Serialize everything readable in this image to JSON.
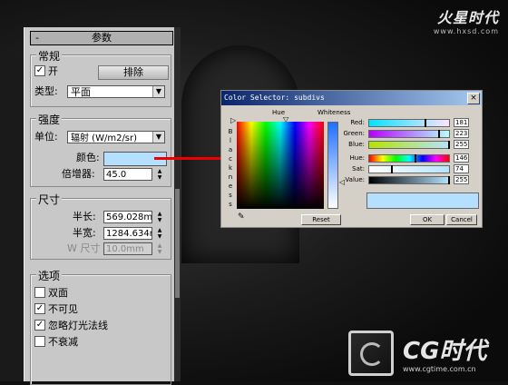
{
  "logos": {
    "top_brand": "火星时代",
    "top_url": "www.hxsd.com",
    "bottom_brand": "CG时代",
    "bottom_url": "www.cgtime.com.cn"
  },
  "rollout": {
    "header": "参数",
    "header_toggle": "-",
    "general": {
      "title": "常规",
      "on_label": "开",
      "on_checked": "✓",
      "exclude_button": "排除",
      "type_label": "类型:",
      "type_value": "平面"
    },
    "intensity": {
      "title": "强度",
      "unit_label": "单位:",
      "unit_value": "辐射 (W/m2/sr)",
      "color_label": "颜色:",
      "multiplier_label": "倍增器:",
      "multiplier_value": "45.0"
    },
    "size": {
      "title": "尺寸",
      "half_length_label": "半长:",
      "half_length_value": "569.028m",
      "half_width_label": "半宽:",
      "half_width_value": "1284.634r",
      "w_size_label": "W 尺寸",
      "w_size_value": "10.0mm"
    },
    "options": {
      "title": "选项",
      "items": [
        {
          "label": "双面",
          "mark": ""
        },
        {
          "label": "不可见",
          "mark": "✓"
        },
        {
          "label": "忽略灯光法线",
          "mark": "✓"
        },
        {
          "label": "不衰减",
          "mark": ""
        }
      ]
    }
  },
  "color_selector": {
    "title": "Color Selector: subdivs",
    "close": "×",
    "hue_header": "Hue",
    "whiteness_header": "Whiteness",
    "blackness_letters": [
      "B",
      "l",
      "a",
      "c",
      "k",
      "n",
      "e",
      "s",
      "s"
    ],
    "sliders": [
      {
        "label": "Red:",
        "value": "181",
        "fill": "linear-gradient(90deg,#00e3ff,#ffe3ff)"
      },
      {
        "label": "Green:",
        "value": "223",
        "fill": "linear-gradient(90deg,#b500ff,#b5ffff)"
      },
      {
        "label": "Blue:",
        "value": "255",
        "fill": "linear-gradient(90deg,#b5e300,#b5e3ff)"
      },
      {
        "label": "Hue:",
        "value": "146",
        "fill": "linear-gradient(90deg,#f00,#ff0,#0f0,#0ff,#00f,#f0f,#f00)"
      },
      {
        "label": "Sat:",
        "value": "74",
        "fill": "linear-gradient(90deg,#fff,#b5e3ff)"
      },
      {
        "label": "Value:",
        "value": "255",
        "fill": "linear-gradient(90deg,#000,#b5e3ff)"
      }
    ],
    "reset_label": "Reset",
    "ok_label": "OK",
    "cancel_label": "Cancel",
    "current_color": "#b5dfff"
  }
}
